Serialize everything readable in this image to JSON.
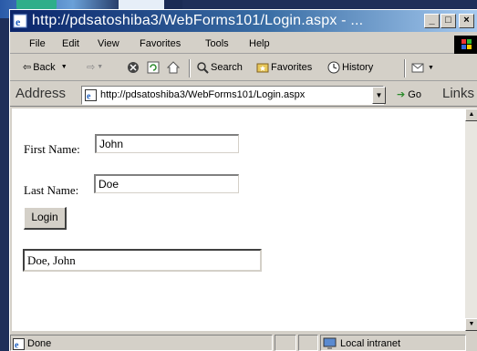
{
  "window": {
    "title": "http://pdsatoshiba3/WebForms101/Login.aspx - ...",
    "buttons": [
      "_",
      "□",
      "×"
    ]
  },
  "menu": [
    "File",
    "Edit",
    "View",
    "Favorites",
    "Tools",
    "Help"
  ],
  "toolbar": {
    "back": "Back",
    "search": "Search",
    "favorites": "Favorites",
    "history": "History"
  },
  "address": {
    "label": "Address",
    "url": "http://pdsatoshiba3/WebForms101/Login.aspx",
    "go": "Go",
    "links": "Links"
  },
  "form": {
    "first_name_label": "First Name:",
    "first_name_value": "John",
    "last_name_label": "Last Name:",
    "last_name_value": "Doe",
    "login_button": "Login",
    "result_value": "Doe, John"
  },
  "status": {
    "text": "Done",
    "zone": "Local intranet"
  }
}
